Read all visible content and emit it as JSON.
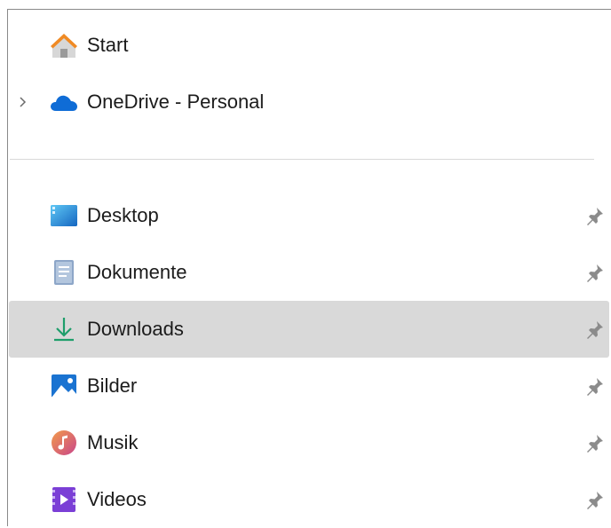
{
  "navigation": {
    "top_items": [
      {
        "label": "Start",
        "icon": "home-icon"
      },
      {
        "label": "OneDrive - Personal",
        "icon": "onedrive-cloud-icon",
        "expandable": true
      }
    ],
    "quick_access": [
      {
        "label": "Desktop",
        "icon": "desktop-folder-icon",
        "pinned": true
      },
      {
        "label": "Dokumente",
        "icon": "documents-icon",
        "pinned": true
      },
      {
        "label": "Downloads",
        "icon": "downloads-icon",
        "pinned": true,
        "selected": true
      },
      {
        "label": "Bilder",
        "icon": "pictures-icon",
        "pinned": true
      },
      {
        "label": "Musik",
        "icon": "music-icon",
        "pinned": true
      },
      {
        "label": "Videos",
        "icon": "videos-icon",
        "pinned": true
      }
    ]
  },
  "colors": {
    "selected_background": "#d9d9d9",
    "divider": "#d8d8d8",
    "onedrive_blue": "#0f6cd6",
    "downloads_green": "#1e9e6b",
    "pin_gray": "#8b8b8b"
  }
}
